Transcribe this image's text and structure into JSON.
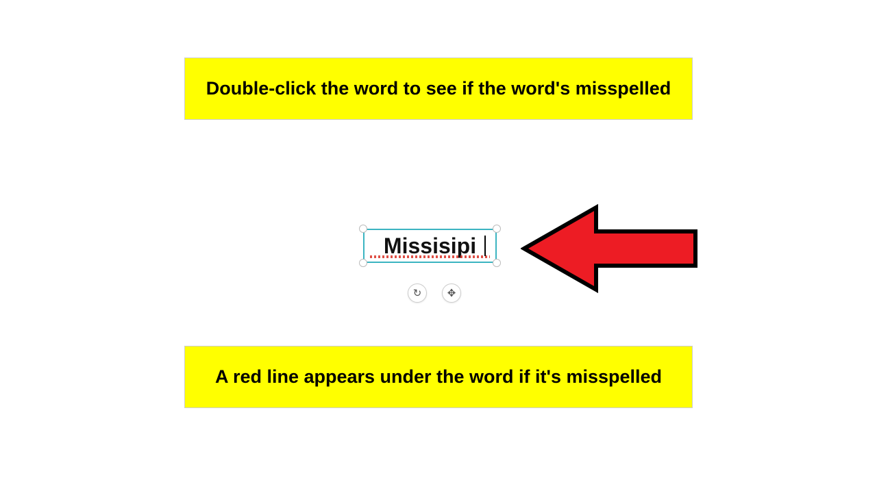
{
  "callouts": {
    "top": "Double-click the word to see if the word's misspelled",
    "bottom": "A red line appears under the word if it's misspelled"
  },
  "textbox": {
    "word": "Missisipi"
  },
  "tools": {
    "rotate": "↻",
    "move": "✥"
  },
  "colors": {
    "highlight": "#ffff00",
    "selection_border": "#3bb4c1",
    "arrow": "#ed1c24"
  }
}
